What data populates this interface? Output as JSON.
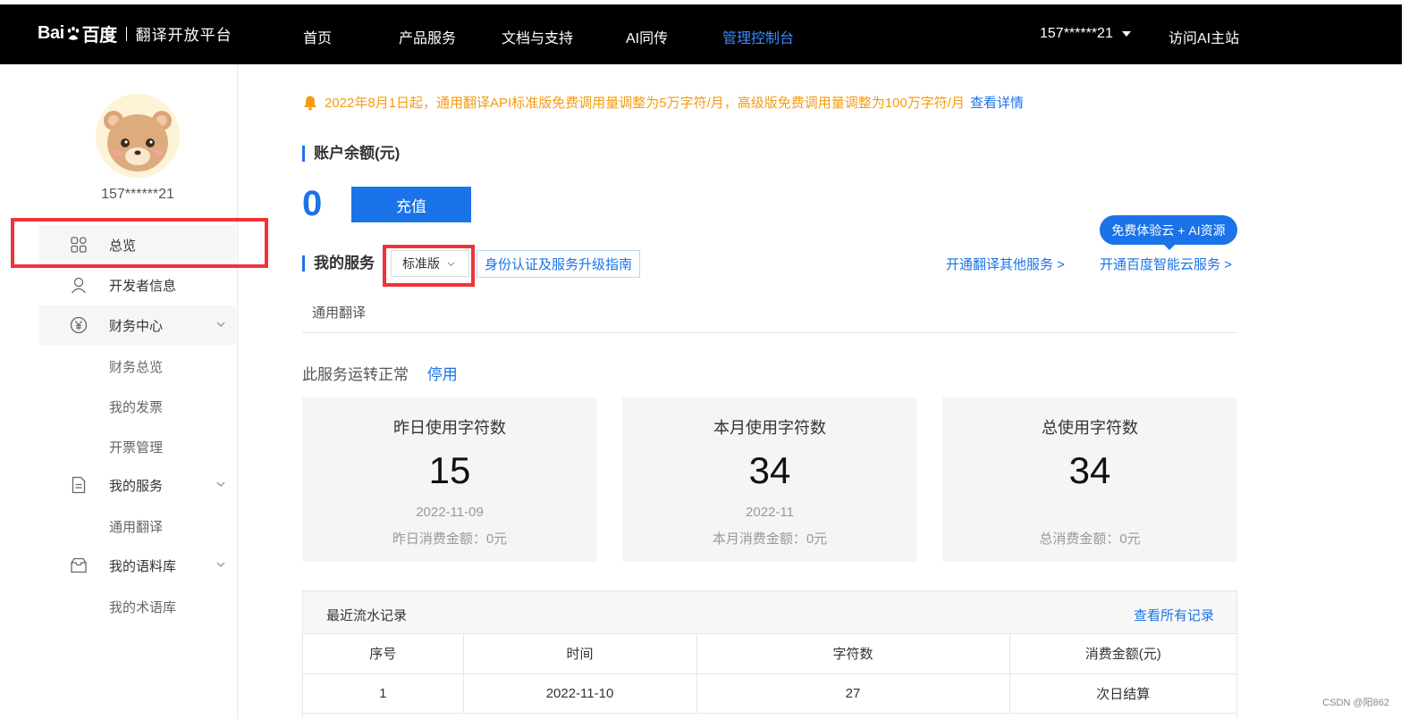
{
  "header": {
    "logo_text": "Bai",
    "logo_text2": "百度",
    "platform": "翻译开放平台",
    "nav": [
      "首页",
      "产品服务",
      "文档与支持",
      "AI同传",
      "管理控制台"
    ],
    "active_index": 4,
    "user": "157******21",
    "visit": "访问AI主站"
  },
  "sidebar": {
    "username": "157******21",
    "items": [
      {
        "label": "总览",
        "icon": "grid-icon"
      },
      {
        "label": "开发者信息",
        "icon": "user-icon"
      },
      {
        "label": "财务中心",
        "icon": "yuan-icon"
      },
      {
        "label": "财务总览"
      },
      {
        "label": "我的发票"
      },
      {
        "label": "开票管理"
      },
      {
        "label": "我的服务",
        "icon": "document-icon"
      },
      {
        "label": "通用翻译"
      },
      {
        "label": "我的语料库",
        "icon": "inbox-icon"
      },
      {
        "label": "我的术语库"
      }
    ]
  },
  "main": {
    "notice": "2022年8月1日起，通用翻译API标准版免费调用量调整为5万字符/月，高级版免费调用量调整为100万字符/月",
    "notice_link": "查看详情",
    "balance_title": "账户余额(元)",
    "balance": "0",
    "recharge": "充值",
    "services_title": "我的服务",
    "version": "标准版",
    "guide": "身份认证及服务升级指南",
    "free_bubble": "免费体验云 + AI资源",
    "open_other": "开通翻译其他服务 >",
    "open_cloud": "开通百度智能云服务 >",
    "tab": "通用翻译",
    "status": "此服务运转正常",
    "stop": "停用",
    "cards": [
      {
        "title": "昨日使用字符数",
        "value": "15",
        "date": "2022-11-09",
        "money": "昨日消费金额：0元"
      },
      {
        "title": "本月使用字符数",
        "value": "34",
        "date": "2022-11",
        "money": "本月消费金额：0元"
      },
      {
        "title": "总使用字符数",
        "value": "34",
        "date": "",
        "money": "总消费金额：0元"
      }
    ],
    "records": {
      "title": "最近流水记录",
      "all": "查看所有记录",
      "columns": [
        "序号",
        "时间",
        "字符数",
        "消费金额(元)"
      ],
      "rows": [
        [
          "1",
          "2022-11-10",
          "27",
          "次日结算"
        ]
      ]
    }
  },
  "watermark": "CSDN @阳862",
  "colors": {
    "accent": "#1a73e8",
    "notice": "#f39c12",
    "highlight_box": "#f0323a"
  }
}
